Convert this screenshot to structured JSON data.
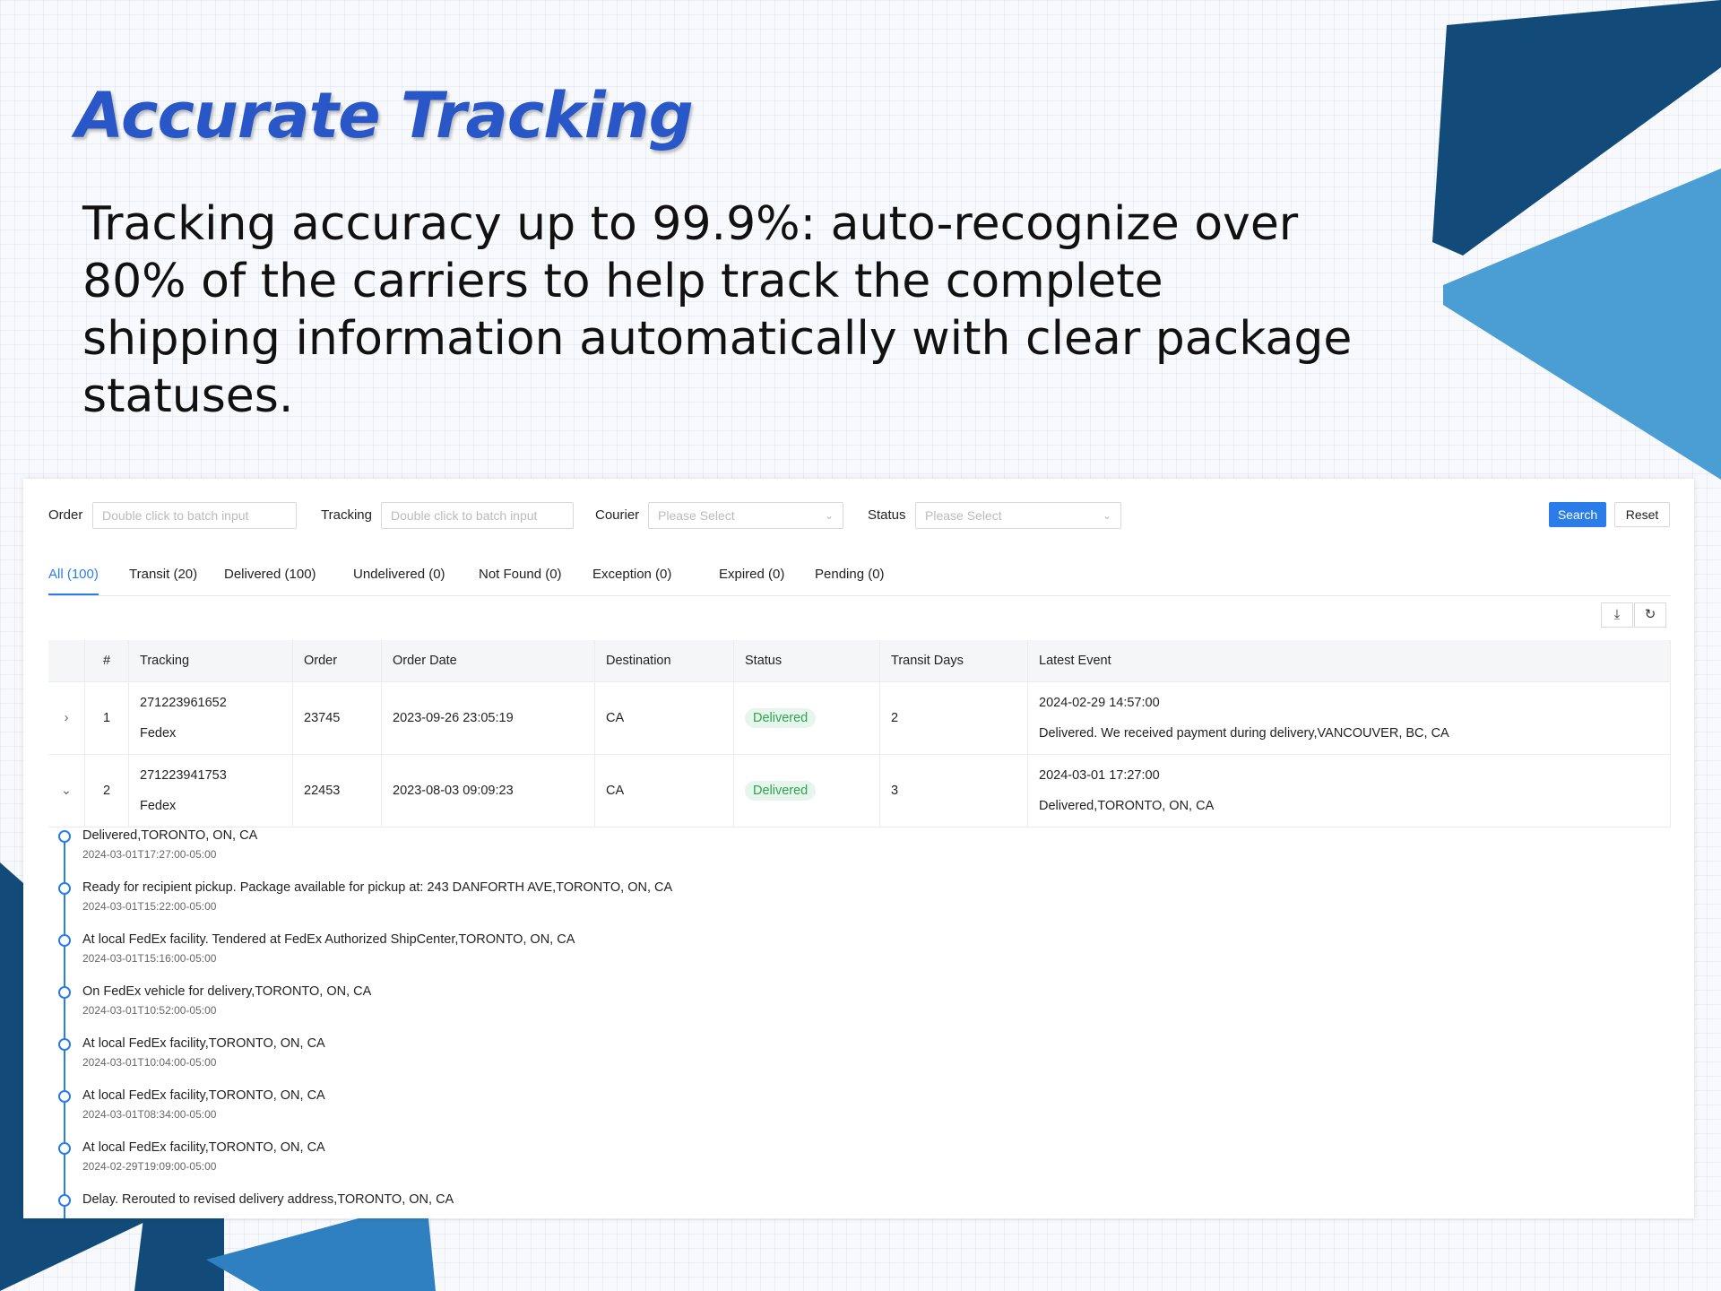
{
  "slide": {
    "title": "Accurate Tracking",
    "subtitle": "Tracking accuracy up to 99.9%: auto-recognize over 80% of the carriers to help track the complete shipping information automatically with clear package statuses."
  },
  "filters": {
    "order_label": "Order",
    "order_placeholder": "Double click to batch input",
    "tracking_label": "Tracking",
    "tracking_placeholder": "Double click to batch input",
    "courier_label": "Courier",
    "courier_placeholder": "Please Select",
    "status_label": "Status",
    "status_placeholder": "Please Select",
    "search_label": "Search",
    "reset_label": "Reset"
  },
  "tabs": [
    "All (100)",
    "Transit (20)",
    "Delivered (100)",
    "Undelivered (0)",
    "Not Found (0)",
    "Exception (0)",
    "Expired (0)",
    "Pending (0)"
  ],
  "table": {
    "headers": [
      "#",
      "Tracking",
      "Order",
      "Order Date",
      "Destination",
      "Status",
      "Transit Days",
      "Latest Event"
    ],
    "rows": [
      {
        "num": "1",
        "tracking": "271223961652",
        "courier": "Fedex",
        "order": "23745",
        "order_date": "2023-09-26 23:05:19",
        "destination": "CA",
        "status": "Delivered",
        "transit_days": "2",
        "event_time": "2024-02-29 14:57:00",
        "event_text": "Delivered. We received payment during delivery,VANCOUVER, BC, CA"
      },
      {
        "num": "2",
        "tracking": "271223941753",
        "courier": "Fedex",
        "order": "22453",
        "order_date": "2023-08-03 09:09:23",
        "destination": "CA",
        "status": "Delivered",
        "transit_days": "3",
        "event_time": "2024-03-01 17:27:00",
        "event_text": "Delivered,TORONTO, ON, CA"
      }
    ]
  },
  "timeline": [
    {
      "text": "Delivered,TORONTO, ON, CA",
      "time": "2024-03-01T17:27:00-05:00"
    },
    {
      "text": "Ready for recipient pickup. Package available for pickup at: 243 DANFORTH AVE,TORONTO, ON, CA",
      "time": "2024-03-01T15:22:00-05:00"
    },
    {
      "text": "At local FedEx facility. Tendered at FedEx Authorized ShipCenter,TORONTO, ON, CA",
      "time": "2024-03-01T15:16:00-05:00"
    },
    {
      "text": "On FedEx vehicle for delivery,TORONTO, ON, CA",
      "time": "2024-03-01T10:52:00-05:00"
    },
    {
      "text": "At local FedEx facility,TORONTO, ON, CA",
      "time": "2024-03-01T10:04:00-05:00"
    },
    {
      "text": "At local FedEx facility,TORONTO, ON, CA",
      "time": "2024-03-01T08:34:00-05:00"
    },
    {
      "text": "At local FedEx facility,TORONTO, ON, CA",
      "time": "2024-02-29T19:09:00-05:00"
    },
    {
      "text": "Delay. Rerouted to revised delivery address,TORONTO, ON, CA",
      "time": ""
    }
  ],
  "icons": {
    "download": "download-icon",
    "refresh": "refresh-icon",
    "expand": "chevron-right-icon",
    "collapse": "chevron-down-icon"
  },
  "colors": {
    "accent": "#2a7de8",
    "title": "#2a57c8",
    "deco_dark": "#124b79",
    "deco_light": "#4a9ed4",
    "badge_bg": "#e6f6ec",
    "badge_text": "#2fa34f"
  }
}
